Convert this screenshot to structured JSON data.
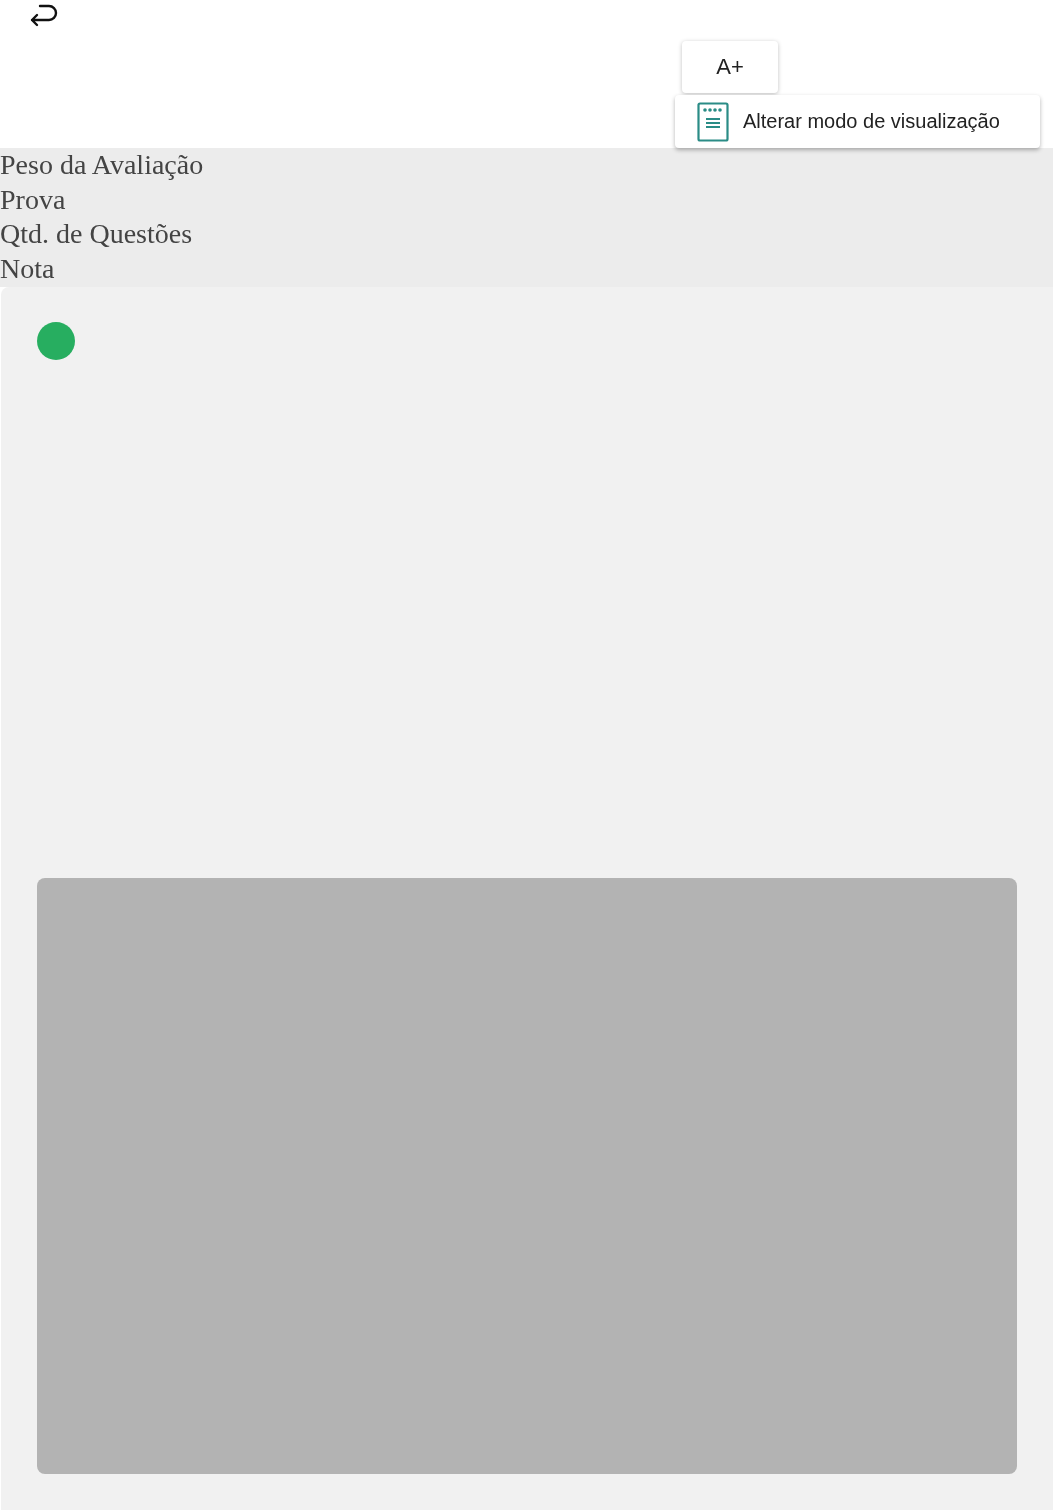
{
  "toolbar": {
    "font_button": "A+"
  },
  "menu": {
    "items": [
      {
        "label": "Alterar modo de visualização"
      }
    ]
  },
  "info_labels": [
    "Peso da Avaliação",
    "Prova",
    "Qtd. de Questões",
    "Nota"
  ]
}
